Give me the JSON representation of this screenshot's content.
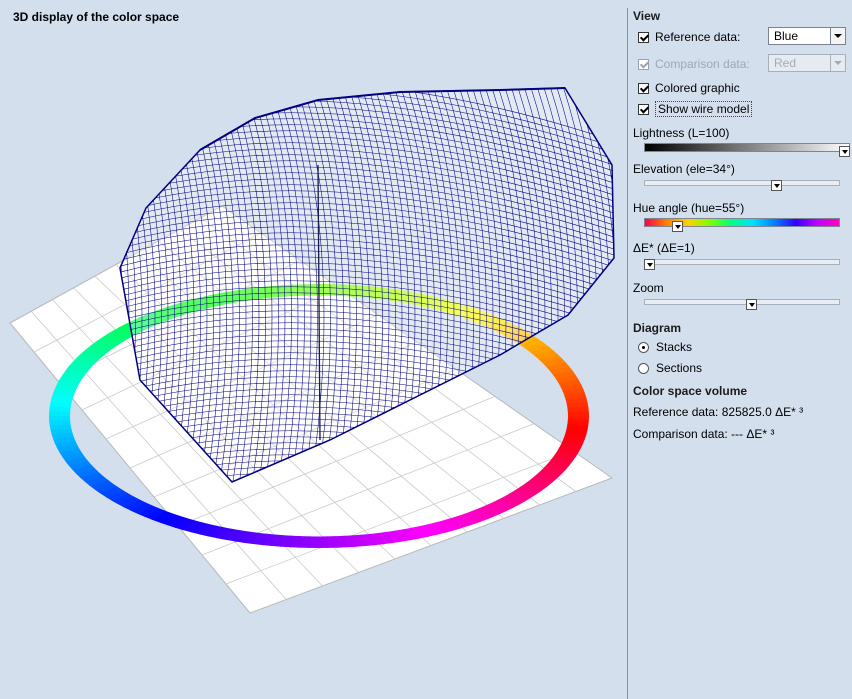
{
  "left": {
    "title": "3D display of the color space"
  },
  "view": {
    "heading": "View",
    "reference": {
      "label": "Reference data:",
      "checked": true,
      "value": "Blue"
    },
    "comparison": {
      "label": "Comparison data:",
      "checked": true,
      "disabled": true,
      "value": "Red"
    },
    "colored_graphic": {
      "label": "Colored graphic",
      "checked": true
    },
    "wire_model": {
      "label": "Show wire model",
      "checked": true
    }
  },
  "sliders": {
    "lightness": {
      "label": "Lightness  (L=100)",
      "value": 100,
      "min": 0,
      "max": 100
    },
    "elevation": {
      "label": "Elevation  (ele=34°)",
      "value": 34,
      "min": -90,
      "max": 90
    },
    "hue": {
      "label": "Hue angle  (hue=55°)",
      "value": 55,
      "min": 0,
      "max": 360
    },
    "delta_e": {
      "label": "ΔE*  (ΔE=1)",
      "value": 1,
      "min": 1,
      "max": 50
    },
    "zoom": {
      "label": "Zoom",
      "fraction": 0.55
    }
  },
  "diagram": {
    "heading": "Diagram",
    "options": [
      {
        "label": "Stacks",
        "selected": true
      },
      {
        "label": "Sections",
        "selected": false
      }
    ]
  },
  "volume": {
    "heading": "Color space volume",
    "reference": "Reference data: 825825.0 ΔE* ³",
    "comparison": "Comparison data: --- ΔE* ³"
  },
  "colors": {
    "wire": "#000080",
    "background": "#d4dfee"
  }
}
